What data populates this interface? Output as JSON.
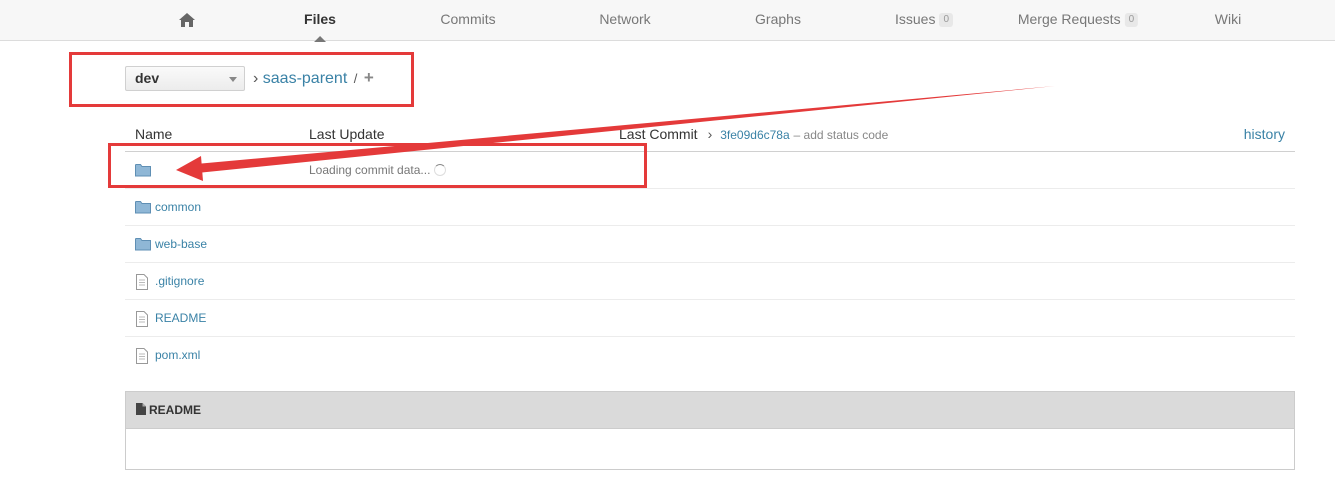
{
  "nav": {
    "home_icon": "home-icon",
    "items": [
      {
        "label": "Files",
        "active": true
      },
      {
        "label": "Commits"
      },
      {
        "label": "Network"
      },
      {
        "label": "Graphs"
      },
      {
        "label": "Issues",
        "count": "0"
      },
      {
        "label": "Merge Requests",
        "count": "0"
      },
      {
        "label": "Wiki"
      }
    ]
  },
  "branch": {
    "selected": "dev"
  },
  "breadcrumb": {
    "separator": "›",
    "repo": "saas-parent",
    "slash": "/",
    "add_icon": "plus-icon"
  },
  "table": {
    "headers": {
      "name": "Name",
      "last_update": "Last Update",
      "last_commit": "Last Commit"
    },
    "commit": {
      "sha": "3fe09d6c78a",
      "message": "– add status code"
    },
    "history": "history",
    "rows": [
      {
        "type": "folder",
        "name": "",
        "status": "Loading commit data..."
      },
      {
        "type": "folder",
        "name": "common"
      },
      {
        "type": "folder",
        "name": "web-base"
      },
      {
        "type": "file",
        "name": ".gitignore"
      },
      {
        "type": "file",
        "name": "README"
      },
      {
        "type": "file",
        "name": "pom.xml"
      }
    ]
  },
  "readme": {
    "title": "README"
  },
  "colors": {
    "link": "#3a82a6",
    "annotation": "#e43a3a"
  }
}
